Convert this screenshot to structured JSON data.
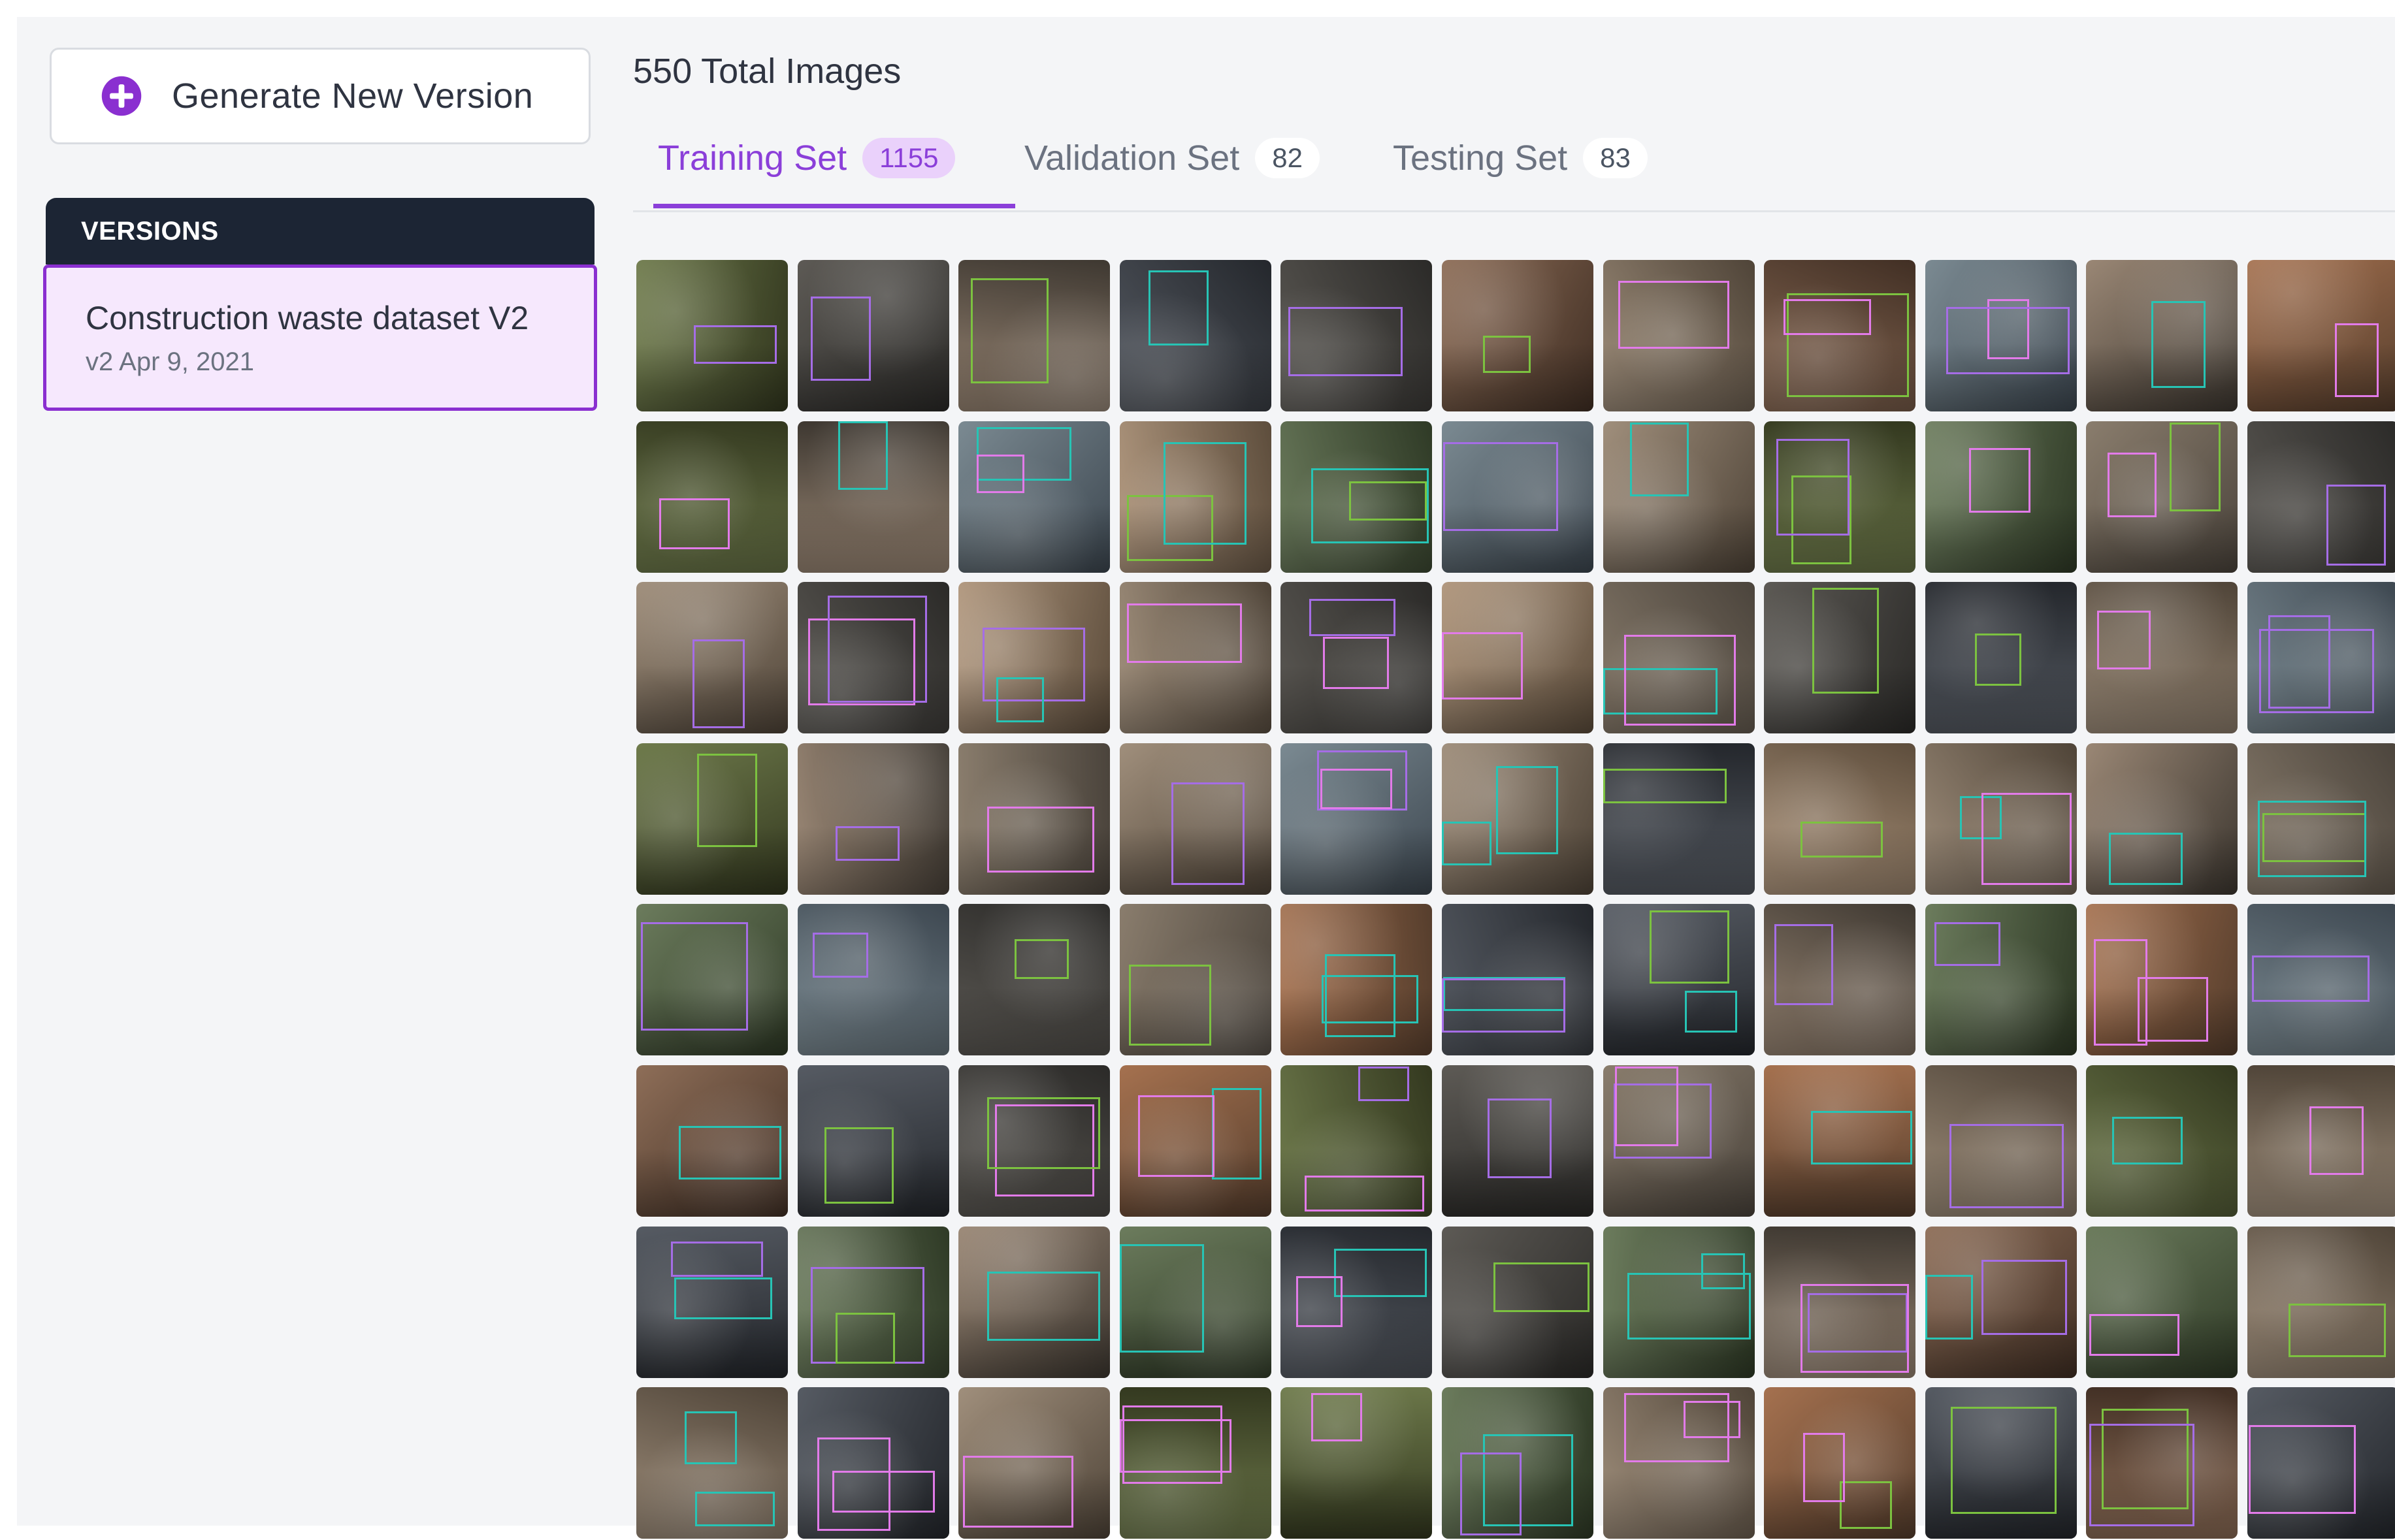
{
  "sidebar": {
    "generate_button": {
      "label": "Generate New Version",
      "icon": "plus-circle-icon",
      "icon_color": "#8a2fd0"
    },
    "versions_header": "VERSIONS",
    "versions": [
      {
        "name": "Construction waste dataset V2",
        "meta": "v2 Apr 9, 2021",
        "selected": true
      }
    ]
  },
  "main": {
    "total_images": "550 Total Images",
    "tabs": [
      {
        "label": "Training Set",
        "count": "1155",
        "active": true
      },
      {
        "label": "Validation Set",
        "count": "82",
        "active": false
      },
      {
        "label": "Testing Set",
        "count": "83",
        "active": false
      }
    ],
    "grid": {
      "columns": 11,
      "rows": 8,
      "thumbnail_count": 88
    }
  },
  "colors": {
    "accent": "#8b3fd9",
    "accent_light": "#ead1fb",
    "selected_card_bg": "#f6e8fd",
    "header_dark": "#1c2534",
    "bbox_pink": "#e27be9",
    "bbox_purple": "#a56de6",
    "bbox_green": "#7cc240",
    "bbox_teal": "#27c4b5"
  }
}
